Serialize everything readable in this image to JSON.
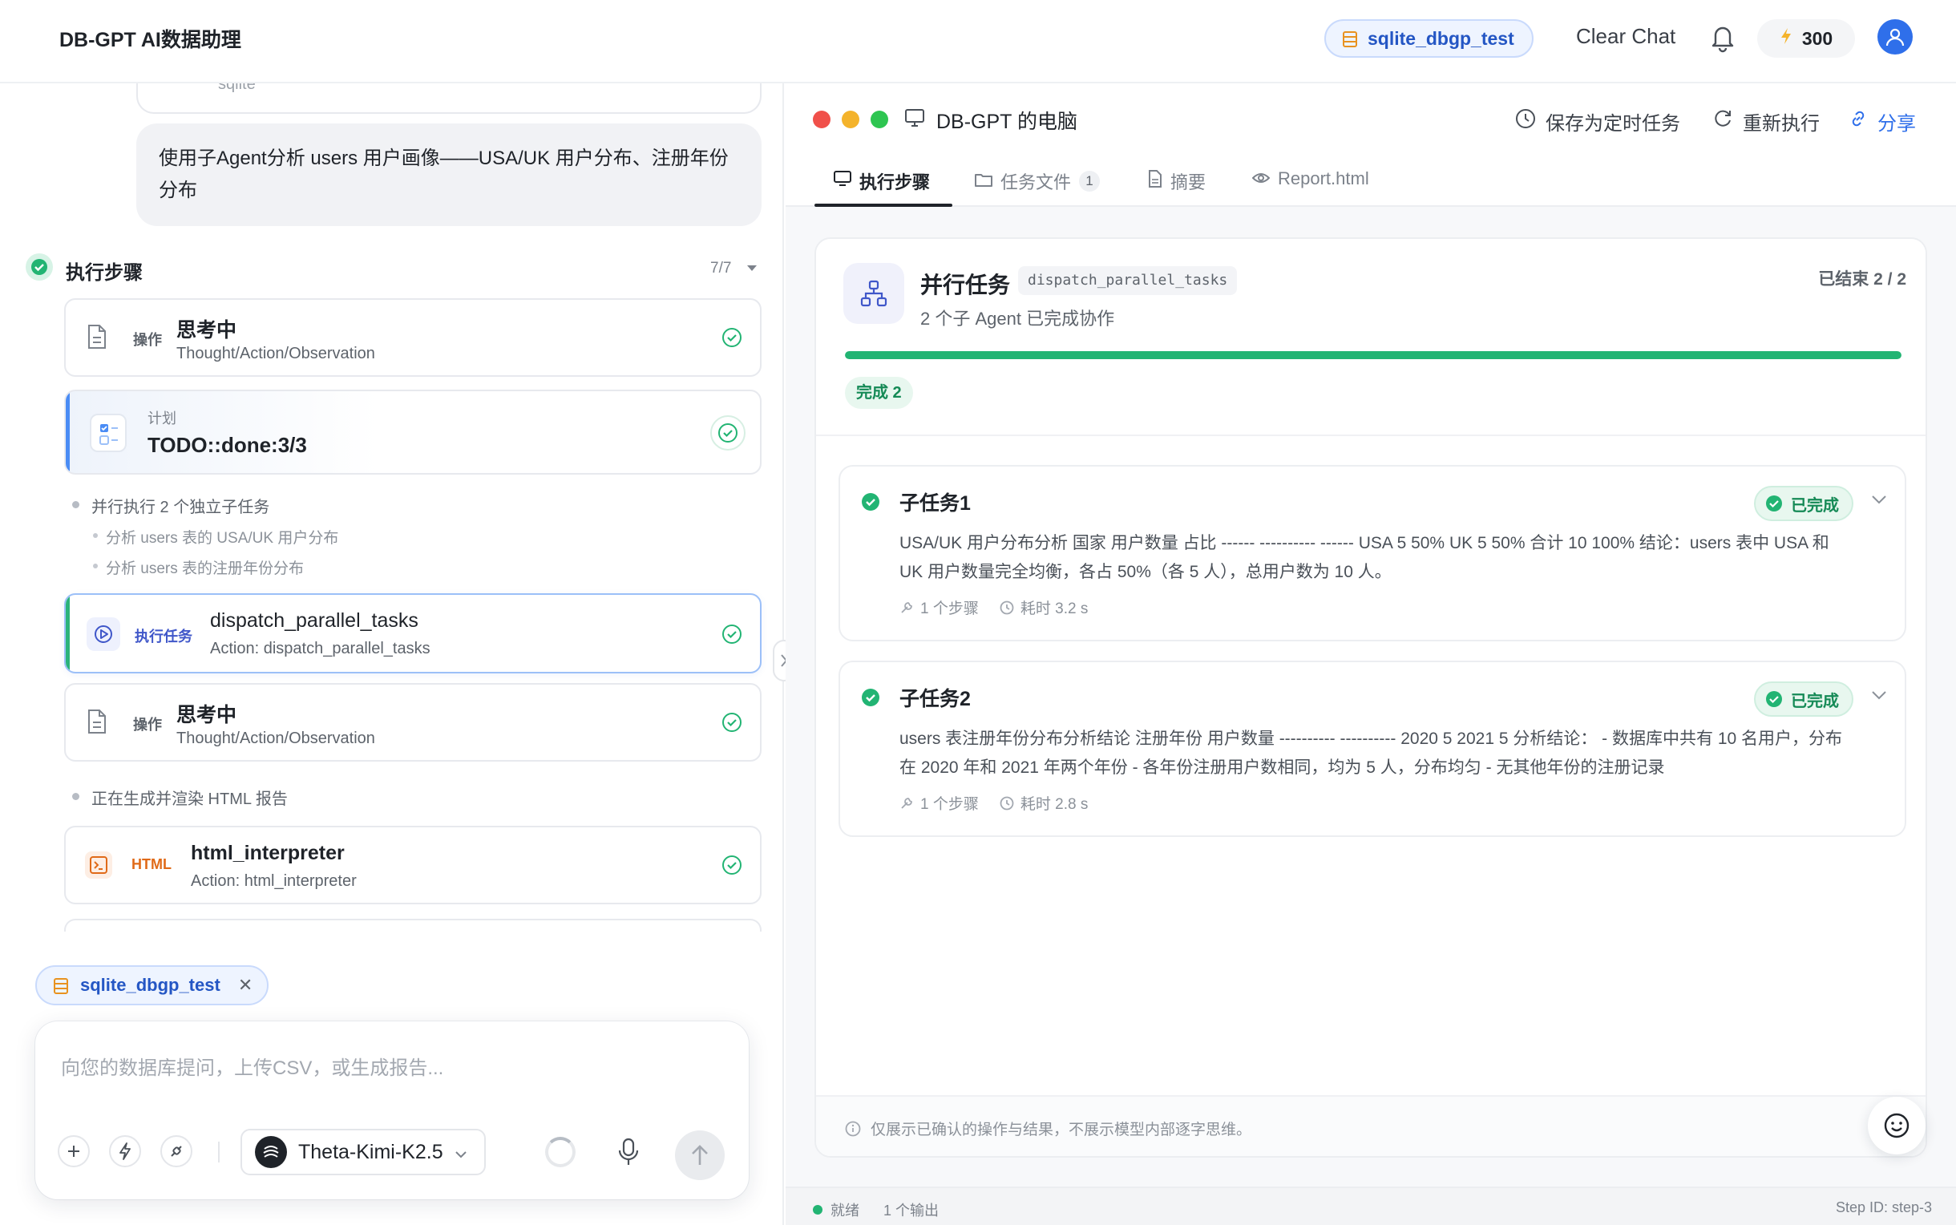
{
  "header": {
    "app_title": "DB-GPT AI数据助理",
    "db_chip": "sqlite_dbgp_test",
    "clear_chat": "Clear Chat",
    "credits": "300"
  },
  "chat": {
    "prev_card_text": "sqlite",
    "user_message": "使用子Agent分析 users 用户画像——USA/UK 用户分布、注册年份分布",
    "steps_title": "执行步骤",
    "steps_count": "7/7",
    "steps": {
      "thinking1": {
        "tag": "操作",
        "title": "思考中",
        "subtitle": "Thought/Action/Observation"
      },
      "plan": {
        "tag": "计划",
        "title": "TODO::done:3/3"
      },
      "parallel_note": "并行执行 2 个独立子任务",
      "sub_notes": [
        "分析 users 表的 USA/UK 用户分布",
        "分析 users 表的注册年份分布"
      ],
      "exec": {
        "tag": "执行任务",
        "title": "dispatch_parallel_tasks",
        "subtitle": "Action: dispatch_parallel_tasks"
      },
      "thinking2": {
        "tag": "操作",
        "title": "思考中",
        "subtitle": "Thought/Action/Observation"
      },
      "render_note": "正在生成并渲染 HTML 报告",
      "html": {
        "tag": "HTML",
        "title": "html_interpreter",
        "subtitle": "Action: html_interpreter"
      }
    },
    "attached_db": "sqlite_dbgp_test",
    "composer": {
      "placeholder": "向您的数据库提问，上传CSV，或生成报告...",
      "model": "Theta-Kimi-K2.5"
    }
  },
  "workspace": {
    "window_title": "DB-GPT 的电脑",
    "actions": {
      "schedule": "保存为定时任务",
      "rerun": "重新执行",
      "share": "分享"
    },
    "tabs": [
      {
        "label": "执行步骤"
      },
      {
        "label": "任务文件",
        "badge": "1"
      },
      {
        "label": "摘要"
      },
      {
        "label": "Report.html"
      }
    ],
    "parallel": {
      "title": "并行任务",
      "code": "dispatch_parallel_tasks",
      "subtitle": "2 个子 Agent 已完成协作",
      "ended": "已结束 2 / 2",
      "progress": 1.0,
      "done_pill": "完成 2"
    },
    "subtasks": [
      {
        "name": "子任务1",
        "status": "已完成",
        "body": "USA/UK 用户分布分析 国家 用户数量 占比 ------ ---------- ------ USA 5 50% UK 5 50% 合计 10 100% 结论：users 表中 USA 和 UK 用户数量完全均衡，各占 50%（各 5 人），总用户数为 10 人。",
        "steps": "1 个步骤",
        "time": "耗时 3.2 s"
      },
      {
        "name": "子任务2",
        "status": "已完成",
        "body": "users 表注册年份分布分析结论 注册年份 用户数量 ---------- ---------- 2020 5 2021 5 分析结论： - 数据库中共有 10 名用户，分布在 2020 年和 2021 年两个年份 - 各年份注册用户数相同，均为 5 人，分布均匀 - 无其他年份的注册记录",
        "steps": "1 个步骤",
        "time": "耗时 2.8 s"
      }
    ],
    "footer_note": "仅展示已确认的操作与结果，不展示模型内部逐字思维。",
    "status_bar": {
      "ready": "就绪",
      "outputs": "1 个输出",
      "step_id": "Step ID: step-3"
    }
  },
  "colors": {
    "accent": "#2f6fea",
    "success": "#22b473",
    "mac_red": "#f0504a",
    "mac_yellow": "#f4b32b",
    "mac_green": "#2ec551"
  }
}
